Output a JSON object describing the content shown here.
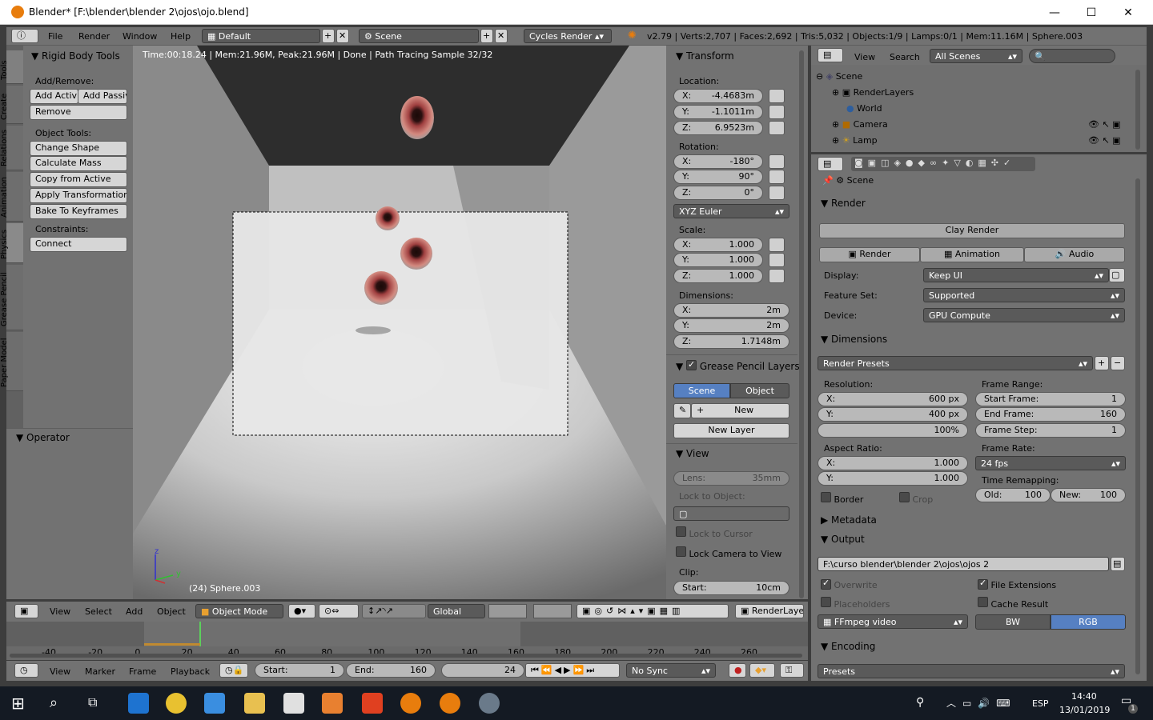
{
  "window": {
    "title": "Blender* [F:\\blender\\blender 2\\ojos\\ojo.blend]",
    "min": "—",
    "max": "☐",
    "close": "✕"
  },
  "topmenu": {
    "file": "File",
    "render": "Render",
    "window": "Window",
    "help": "Help",
    "layout": "Default",
    "scene": "Scene",
    "engine": "Cycles Render",
    "info": "v2.79 | Verts:2,707 | Faces:2,692 | Tris:5,032 | Objects:1/9 | Lamps:0/1 | Mem:11.16M | Sphere.003"
  },
  "tool_tabs": [
    "Tools",
    "Create",
    "Relations",
    "Animation",
    "Physics",
    "Grease Pencil",
    "Paper Model"
  ],
  "tools": {
    "title": "Rigid Body Tools",
    "add_remove": "Add/Remove:",
    "add_active": "Add Activ",
    "add_passive": "Add Passiv",
    "remove": "Remove",
    "object_tools": "Object Tools:",
    "change_shape": "Change Shape",
    "calc_mass": "Calculate Mass",
    "copy_active": "Copy from Active",
    "apply_transform": "Apply Transformation",
    "bake": "Bake To Keyframes",
    "constraints": "Constraints:",
    "connect": "Connect"
  },
  "operator": {
    "title": "Operator"
  },
  "viewport": {
    "status": "Time:00:18.24 | Mem:21.96M, Peak:21.96M | Done | Path Tracing Sample 32/32",
    "object_label": "(24) Sphere.003",
    "axis_z": "z",
    "axis_y": "y"
  },
  "transform": {
    "title": "Transform",
    "location": "Location:",
    "loc": [
      {
        "a": "X:",
        "v": "-4.4683m"
      },
      {
        "a": "Y:",
        "v": "-1.1011m"
      },
      {
        "a": "Z:",
        "v": "6.9523m"
      }
    ],
    "rotation": "Rotation:",
    "rot": [
      {
        "a": "X:",
        "v": "-180°"
      },
      {
        "a": "Y:",
        "v": "90°"
      },
      {
        "a": "Z:",
        "v": "0°"
      }
    ],
    "rotation_mode": "XYZ Euler",
    "scale": "Scale:",
    "scl": [
      {
        "a": "X:",
        "v": "1.000"
      },
      {
        "a": "Y:",
        "v": "1.000"
      },
      {
        "a": "Z:",
        "v": "1.000"
      }
    ],
    "dimensions": "Dimensions:",
    "dim": [
      {
        "a": "X:",
        "v": "2m"
      },
      {
        "a": "Y:",
        "v": "2m"
      },
      {
        "a": "Z:",
        "v": "1.7148m"
      }
    ]
  },
  "grease": {
    "title": "Grease Pencil Layers",
    "scene": "Scene",
    "object": "Object",
    "new": "New",
    "new_layer": "New Layer"
  },
  "view": {
    "title": "View",
    "lens": "Lens:",
    "lens_val": "35mm",
    "lock_obj": "Lock to Object:",
    "lock_cursor": "Lock to Cursor",
    "lock_cam": "Lock Camera to View",
    "clip": "Clip:",
    "start": "Start:",
    "start_val": "10cm"
  },
  "outliner": {
    "view": "View",
    "search": "Search",
    "scenes": "All Scenes",
    "items": [
      {
        "name": "Scene"
      },
      {
        "name": "RenderLayers"
      },
      {
        "name": "World"
      },
      {
        "name": "Camera"
      },
      {
        "name": "Lamp"
      }
    ]
  },
  "props": {
    "breadcrumb": "Scene",
    "render_title": "Render",
    "clay": "Clay Render",
    "render_btn": "Render",
    "animation_btn": "Animation",
    "audio_btn": "Audio",
    "display": "Display:",
    "display_val": "Keep UI",
    "feature": "Feature Set:",
    "feature_val": "Supported",
    "device": "Device:",
    "device_val": "GPU Compute",
    "dimensions_title": "Dimensions",
    "presets": "Render Presets",
    "resolution": "Resolution:",
    "res_x": "600 px",
    "res_y": "400 px",
    "res_pct": "100%",
    "frame_range": "Frame Range:",
    "start_frame": "Start Frame:",
    "start_frame_val": "1",
    "end_frame": "End Frame:",
    "end_frame_val": "160",
    "frame_step": "Frame Step:",
    "frame_step_val": "1",
    "aspect": "Aspect Ratio:",
    "asp_x": "1.000",
    "asp_y": "1.000",
    "frame_rate": "Frame Rate:",
    "fps": "24 fps",
    "time_remap": "Time Remapping:",
    "old": "Old:",
    "old_val": "100",
    "new": "New:",
    "new_val": "100",
    "border": "Border",
    "crop": "Crop",
    "metadata": "Metadata",
    "output": "Output",
    "output_path": "F:\\curso blender\\blender 2\\ojos\\ojos 2",
    "overwrite": "Overwrite",
    "file_ext": "File Extensions",
    "placeholders": "Placeholders",
    "cache": "Cache Result",
    "format": "FFmpeg video",
    "bw": "BW",
    "rgb": "RGB",
    "encoding": "Encoding",
    "presets2": "Presets",
    "x": "X:",
    "y": "Y:"
  },
  "bottom": {
    "view": "View",
    "select": "Select",
    "add": "Add",
    "object": "Object",
    "mode": "Object Mode",
    "orientation": "Global",
    "layer": "RenderLayer"
  },
  "timeline": {
    "ticks": [
      "-40",
      "-20",
      "0",
      "20",
      "40",
      "60",
      "80",
      "100",
      "120",
      "140",
      "160",
      "180",
      "200",
      "220",
      "240",
      "260"
    ]
  },
  "tlbar": {
    "view": "View",
    "marker": "Marker",
    "frame": "Frame",
    "playback": "Playback",
    "start": "Start:",
    "start_val": "1",
    "end": "End:",
    "end_val": "160",
    "cur": "24",
    "sync": "No Sync"
  },
  "taskbar": {
    "lang": "ESP",
    "time": "14:40",
    "date": "13/01/2019",
    "notif": "1"
  }
}
